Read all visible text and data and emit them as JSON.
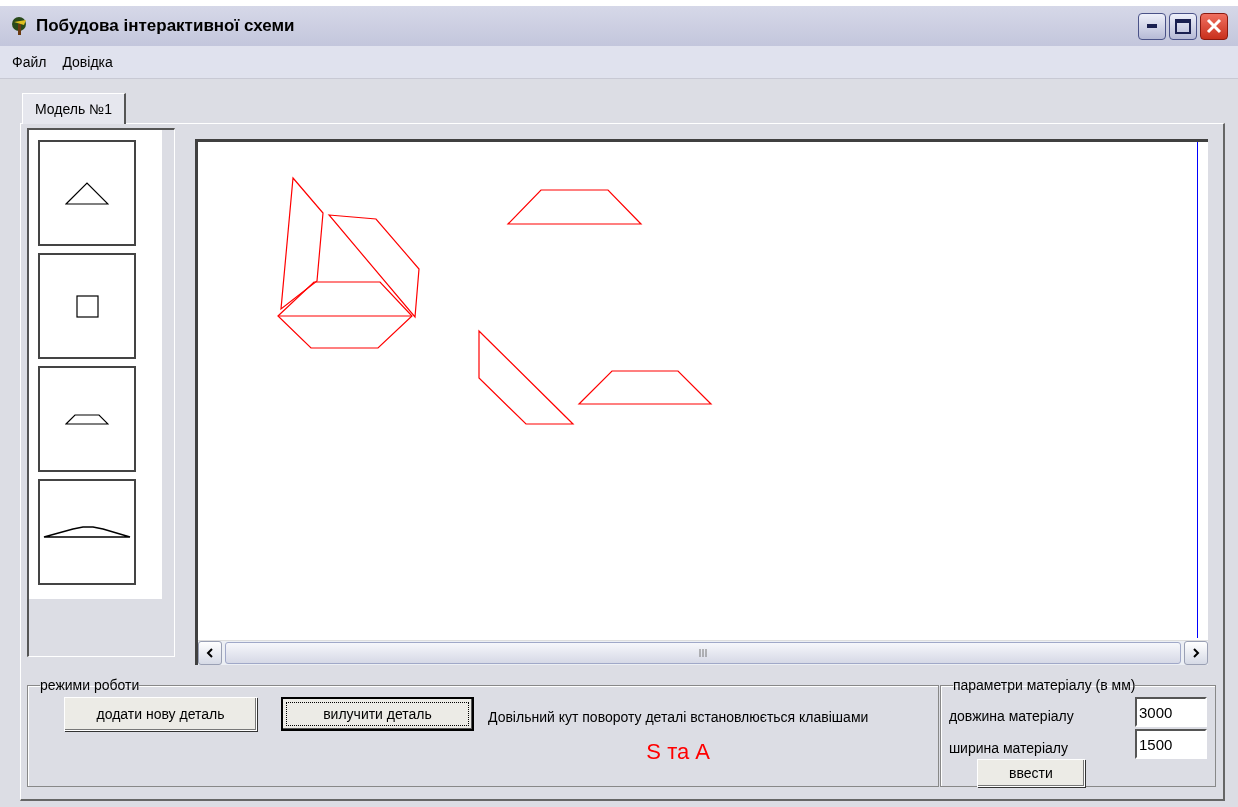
{
  "window": {
    "title": "Побудова інтерактивної схеми"
  },
  "menu": [
    "Файл",
    "Довідка"
  ],
  "tabs": [
    {
      "label": "Модель №1",
      "selected": true
    }
  ],
  "palette": [
    {
      "kind": "triangle"
    },
    {
      "kind": "square"
    },
    {
      "kind": "trapezoid"
    },
    {
      "kind": "arc"
    }
  ],
  "modes": {
    "title": "режими роботи",
    "buttons": [
      {
        "label": "додати нову деталь",
        "focused": false
      },
      {
        "label": "вилучити деталь",
        "focused": true
      }
    ],
    "hint": "Довільний кут повороту деталі встановлюється клавішами",
    "keys": "S та A"
  },
  "material": {
    "title": "параметри матеріалу (в мм)",
    "fields": [
      {
        "label": "довжина матеріалу",
        "value": "3000"
      },
      {
        "label": "ширина матеріалу",
        "value": "1500"
      }
    ],
    "button": "ввести"
  }
}
